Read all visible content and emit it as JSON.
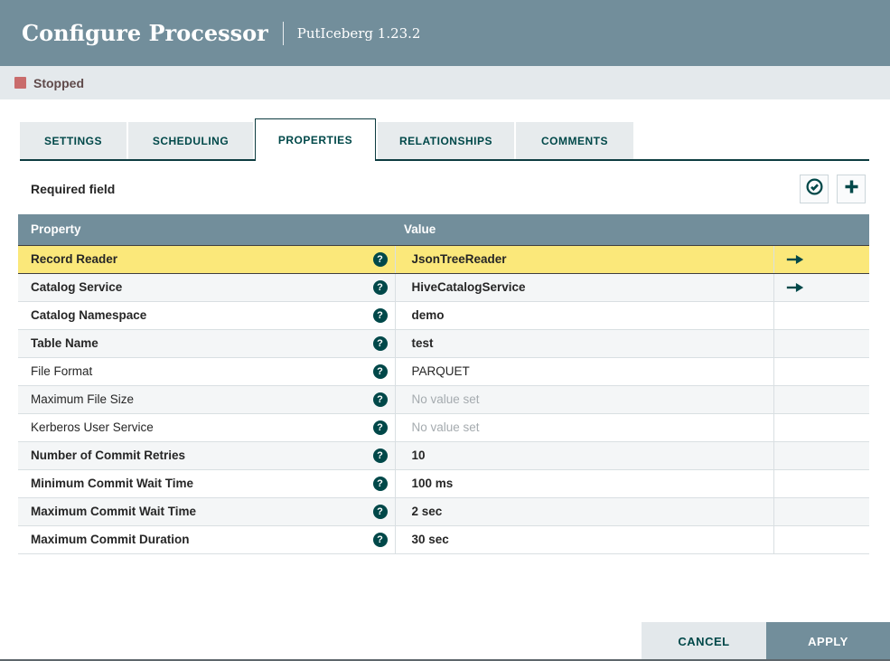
{
  "header": {
    "title": "Configure Processor",
    "subtitle": "PutIceberg 1.23.2"
  },
  "status": {
    "label": "Stopped"
  },
  "tabs": [
    {
      "label": "SETTINGS",
      "active": false
    },
    {
      "label": "SCHEDULING",
      "active": false
    },
    {
      "label": "PROPERTIES",
      "active": true
    },
    {
      "label": "RELATIONSHIPS",
      "active": false
    },
    {
      "label": "COMMENTS",
      "active": false
    }
  ],
  "toolbar": {
    "required_field_label": "Required field",
    "buttons": [
      {
        "name": "verify-properties",
        "icon": "check-circle-icon"
      },
      {
        "name": "add-property",
        "icon": "plus-icon"
      }
    ]
  },
  "table": {
    "columns": [
      "Property",
      "Value"
    ],
    "rows": [
      {
        "property": "Record Reader",
        "required": true,
        "value": "JsonTreeReader",
        "value_set": true,
        "has_goto": true,
        "selected": true
      },
      {
        "property": "Catalog Service",
        "required": true,
        "value": "HiveCatalogService",
        "value_set": true,
        "has_goto": true,
        "selected": false
      },
      {
        "property": "Catalog Namespace",
        "required": true,
        "value": "demo",
        "value_set": true,
        "has_goto": false,
        "selected": false
      },
      {
        "property": "Table Name",
        "required": true,
        "value": "test",
        "value_set": true,
        "has_goto": false,
        "selected": false
      },
      {
        "property": "File Format",
        "required": false,
        "value": "PARQUET",
        "value_set": true,
        "has_goto": false,
        "selected": false
      },
      {
        "property": "Maximum File Size",
        "required": false,
        "value": "No value set",
        "value_set": false,
        "has_goto": false,
        "selected": false
      },
      {
        "property": "Kerberos User Service",
        "required": false,
        "value": "No value set",
        "value_set": false,
        "has_goto": false,
        "selected": false
      },
      {
        "property": "Number of Commit Retries",
        "required": true,
        "value": "10",
        "value_set": true,
        "has_goto": false,
        "selected": false
      },
      {
        "property": "Minimum Commit Wait Time",
        "required": true,
        "value": "100 ms",
        "value_set": true,
        "has_goto": false,
        "selected": false
      },
      {
        "property": "Maximum Commit Wait Time",
        "required": true,
        "value": "2 sec",
        "value_set": true,
        "has_goto": false,
        "selected": false
      },
      {
        "property": "Maximum Commit Duration",
        "required": true,
        "value": "30 sec",
        "value_set": true,
        "has_goto": false,
        "selected": false
      }
    ]
  },
  "footer": {
    "cancel_label": "CANCEL",
    "apply_label": "APPLY"
  },
  "colors": {
    "header_background": "#728e9b",
    "accent_teal": "#004849",
    "tab_border": "#0d3c40",
    "selected_row_background": "#fbe87a",
    "stopped_red": "#c96c6c",
    "row_alt_background": "#f4f6f7",
    "cancel_button_background": "#e3e8eb",
    "apply_button_background": "#728e9b",
    "no_value_text": "#a5abaf"
  }
}
